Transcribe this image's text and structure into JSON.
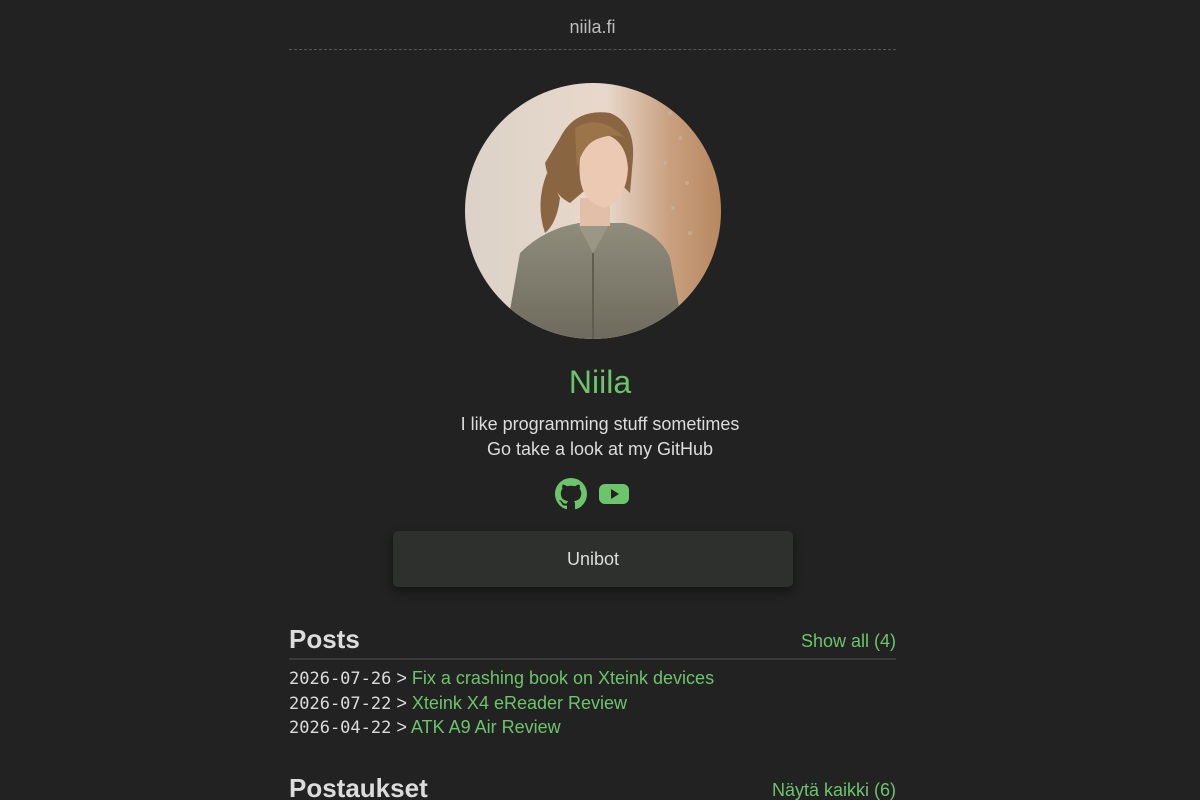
{
  "header": {
    "site_title": "niila.fi"
  },
  "profile": {
    "name": "Niila",
    "bio_line1": "I like programming stuff sometimes",
    "bio_line2": "Go take a look at my GitHub",
    "avatar_icon": "profile-photo",
    "socials": [
      {
        "icon": "github-icon"
      },
      {
        "icon": "youtube-icon"
      }
    ]
  },
  "projects": {
    "button_label": "Unibot"
  },
  "posts": {
    "title": "Posts",
    "show_all": "Show all (4)",
    "separator": ">",
    "items": [
      {
        "date": "2026-07-26",
        "title": "Fix a crashing book on Xteink devices"
      },
      {
        "date": "2026-07-22",
        "title": "Xteink X4 eReader Review"
      },
      {
        "date": "2026-04-22",
        "title": "ATK A9 Air Review"
      }
    ]
  },
  "postaukset": {
    "title": "Postaukset",
    "show_all": "Näytä kaikki (6)"
  },
  "colors": {
    "background": "#222222",
    "accent": "#6cc46b",
    "text": "#dcdcdc",
    "button_bg": "#2e302d"
  }
}
